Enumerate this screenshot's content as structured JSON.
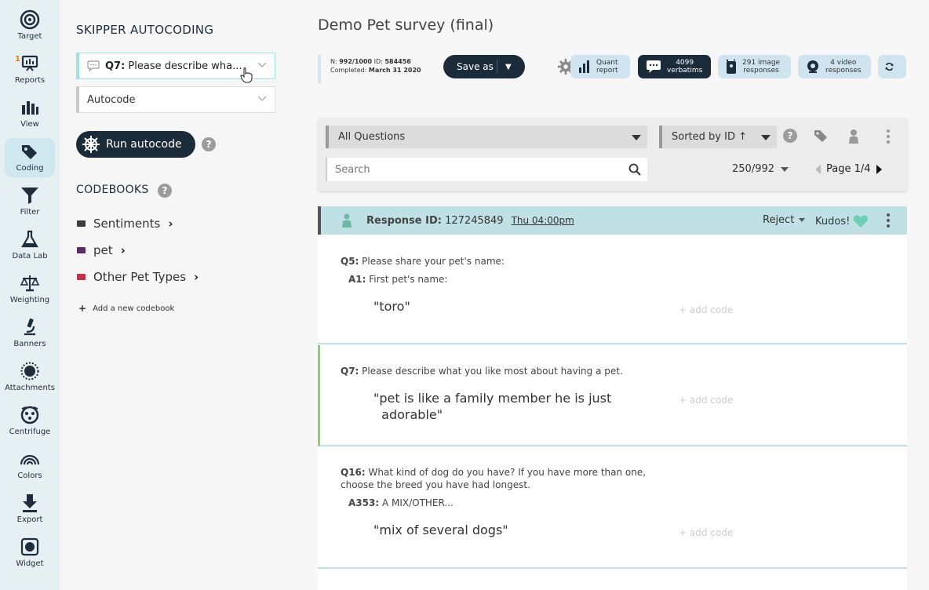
{
  "rail": [
    {
      "label": "Target",
      "icon": "target-icon"
    },
    {
      "label": "Reports",
      "icon": "reports-icon",
      "badge": "1"
    },
    {
      "label": "View",
      "icon": "bar-chart-icon"
    },
    {
      "label": "Coding",
      "icon": "tags-icon",
      "active": true
    },
    {
      "label": "Filter",
      "icon": "filter-icon"
    },
    {
      "label": "Data Lab",
      "icon": "flask-icon"
    },
    {
      "label": "Weighting",
      "icon": "scale-icon"
    },
    {
      "label": "Banners",
      "icon": "microscope-icon"
    },
    {
      "label": "Attachments",
      "icon": "attachments-icon"
    },
    {
      "label": "Centrifuge",
      "icon": "centrifuge-icon"
    },
    {
      "label": "Colors",
      "icon": "rainbow-icon"
    },
    {
      "label": "Export",
      "icon": "download-icon"
    },
    {
      "label": "Widget",
      "icon": "widget-icon"
    }
  ],
  "panel": {
    "title": "SKIPPER AUTOCODING",
    "question_select": "Q7: Please describe wha...",
    "question_prefix": "Q7:",
    "question_rest": " Please describe wha...",
    "mode_select": "Autocode",
    "run_button": "Run autocode",
    "codebooks_title": "CODEBOOKS",
    "codebooks": [
      {
        "name": "Sentiments",
        "color": "#3b3b3b"
      },
      {
        "name": "pet",
        "color": "#5a2d66"
      },
      {
        "name": "Other Pet Types",
        "color": "#c0324a"
      }
    ],
    "add_codebook": "Add a new codebook"
  },
  "main": {
    "title": "Demo Pet survey (final)",
    "meta": {
      "n_label": "N:",
      "n_value": "992/1000",
      "id_label": "ID:",
      "id_value": "584456",
      "completed_label": "Completed:",
      "completed_value": "March 31 2020"
    },
    "save_as": "Save as",
    "pills": [
      {
        "line1": "Quant",
        "line2": "report",
        "icon": "bar-chart-icon"
      },
      {
        "line1": "4099",
        "line2": "verbatims",
        "icon": "speech-bubble-icon",
        "dark": true
      },
      {
        "line1": "291 image",
        "line2": "responses",
        "icon": "image-icon"
      },
      {
        "line1": "4 video",
        "line2": "responses",
        "icon": "webcam-icon"
      }
    ],
    "filter": {
      "questions": "All Questions",
      "sorted": "Sorted by ID ↑",
      "search_placeholder": "Search",
      "count": "250/992",
      "page": "Page 1/4"
    },
    "response": {
      "id_label": "Response ID:",
      "id_value": "127245849",
      "time": "Thu 04:00pm",
      "reject": "Reject",
      "kudos": "Kudos!"
    },
    "cards": [
      {
        "q_label": "Q5:",
        "q_text": " Please share your pet's name:",
        "a_label": "A1:",
        "a_text": " First pet's name:",
        "quote": "\"toro\"",
        "add_code": "+ add code"
      },
      {
        "q_label": "Q7:",
        "q_text": " Please describe what you like most about having a pet.",
        "quote_line1": "\"pet is like a family member he is just",
        "quote_line2": "adorable\"",
        "add_code": "+ add code"
      },
      {
        "q_label": "Q16:",
        "q_text_line1": " What kind of dog do you have? If you have more than one,",
        "q_text_line2": "choose the breed you have had longest.",
        "a_label": "A353:",
        "a_text": " A MIX/OTHER...",
        "quote": "\"mix of several dogs\"",
        "add_code": "+ add code"
      }
    ]
  }
}
